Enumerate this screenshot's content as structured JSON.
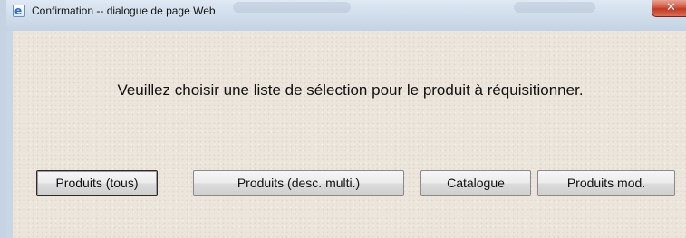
{
  "window": {
    "title": "Confirmation -- dialogue de page Web",
    "icon": "internet-explorer-icon",
    "close_icon": "close-icon"
  },
  "dialog": {
    "message": "Veuillez choisir une liste de sélection pour le produit à réquisitionner.",
    "buttons": [
      {
        "label": "Produits (tous)",
        "default": true
      },
      {
        "label": "Produits (desc. multi.)",
        "default": false
      },
      {
        "label": "Catalogue",
        "default": false
      },
      {
        "label": "Produits mod.",
        "default": false
      }
    ]
  },
  "colors": {
    "dialog_background": "#ece5dc",
    "close_button": "#c13a23",
    "title_bar": "#cfdcea"
  }
}
